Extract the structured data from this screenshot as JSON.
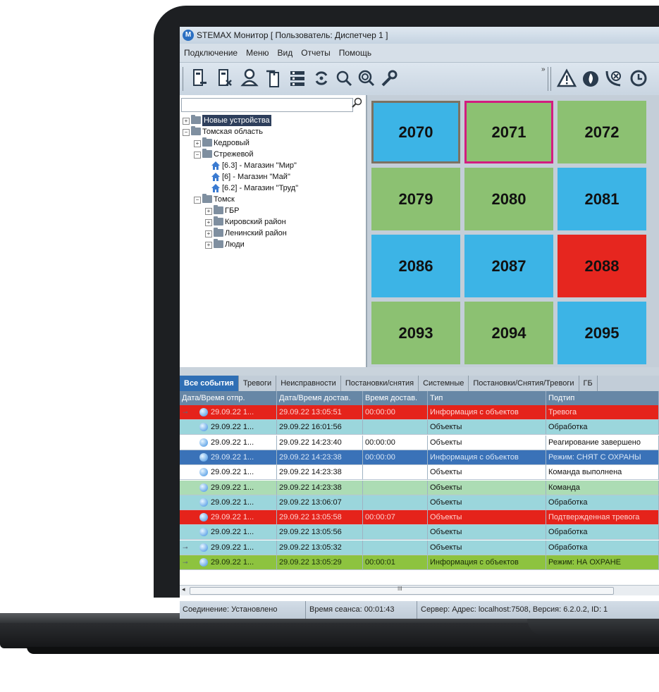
{
  "window": {
    "title": "STEMAX Монитор [ Пользователь: Диспетчер 1 ]",
    "logo_letter": "M"
  },
  "menu": [
    "Подключение",
    "Меню",
    "Вид",
    "Отчеты",
    "Помощь"
  ],
  "toolbar": {
    "icons": [
      "device-remove-icon",
      "device-x-icon",
      "user-icon",
      "pointer-device-icon",
      "list-icon",
      "refresh-icon",
      "search-icon",
      "zoom-in-icon",
      "wrench-icon",
      "alarm-triangle-icon",
      "fire-icon",
      "sound-off-icon",
      "clock-icon"
    ],
    "overflow_label": "»"
  },
  "tree": {
    "search_placeholder": "",
    "nodes": [
      {
        "label": "Новые устройства",
        "kind": "folder",
        "level": 0,
        "toggle": "+",
        "selected": true
      },
      {
        "label": "Томская область",
        "kind": "folder",
        "level": 0,
        "toggle": "−"
      },
      {
        "label": "Кедровый",
        "kind": "folder",
        "level": 1,
        "toggle": "+"
      },
      {
        "label": "Стрежевой",
        "kind": "folder",
        "level": 1,
        "toggle": "−"
      },
      {
        "label": "[6.3] - Магазин \"Мир\"",
        "kind": "object",
        "level": 2
      },
      {
        "label": "[6] - Магазин \"Май\"",
        "kind": "object",
        "level": 2
      },
      {
        "label": "[6.2] - Магазин \"Труд\"",
        "kind": "object",
        "level": 2
      },
      {
        "label": "Томск",
        "kind": "folder",
        "level": 1,
        "toggle": "−"
      },
      {
        "label": "ГБР",
        "kind": "folder",
        "level": 2,
        "toggle": "+"
      },
      {
        "label": "Кировский район",
        "kind": "folder",
        "level": 2,
        "toggle": "+"
      },
      {
        "label": "Ленинский район",
        "kind": "folder",
        "level": 2,
        "toggle": "+"
      },
      {
        "label": "Люди",
        "kind": "folder",
        "level": 2,
        "toggle": "+"
      }
    ]
  },
  "tiles": [
    {
      "number": "2070",
      "color": "#3cb4e6"
    },
    {
      "number": "2071",
      "color": "#8cc172",
      "selected": true
    },
    {
      "number": "2072",
      "color": "#8cc172"
    },
    {
      "number": "2079",
      "color": "#8cc172"
    },
    {
      "number": "2080",
      "color": "#8cc172"
    },
    {
      "number": "2081",
      "color": "#3cb4e6"
    },
    {
      "number": "2086",
      "color": "#3cb4e6"
    },
    {
      "number": "2087",
      "color": "#3cb4e6"
    },
    {
      "number": "2088",
      "color": "#e6261f"
    },
    {
      "number": "2093",
      "color": "#8cc172"
    },
    {
      "number": "2094",
      "color": "#8cc172"
    },
    {
      "number": "2095",
      "color": "#3cb4e6"
    }
  ],
  "events": {
    "tabs": [
      "Все события",
      "Тревоги",
      "Неисправности",
      "Постановки/снятия",
      "Системные",
      "Постановки/Снятия/Тревоги",
      "ГБ"
    ],
    "columns": [
      "Дата/Время отпр.",
      "Дата/Время достав.",
      "Время достав.",
      "Тип",
      "Подтип"
    ],
    "rows": [
      {
        "sent": "29.09.22 1...",
        "delivered": "29.09.22 13:05:51",
        "delay": "00:00:00",
        "type": "Информация с объектов",
        "subtype": "Тревога",
        "bg": "#e5231b",
        "fg": "#ffd2d0",
        "lead": "pin-expand"
      },
      {
        "sent": "29.09.22 1...",
        "delivered": "29.09.22 16:01:56",
        "delay": "",
        "type": "Объекты",
        "subtype": "Обработка",
        "bg": "#9bd6dc",
        "fg": "#111111"
      },
      {
        "sent": "29.09.22 1...",
        "delivered": "29.09.22 14:23:40",
        "delay": "00:00:00",
        "type": "Объекты",
        "subtype": "Реагирование завершено",
        "bg": "#ffffff",
        "fg": "#111111"
      },
      {
        "sent": "29.09.22 1...",
        "delivered": "29.09.22 14:23:38",
        "delay": "00:00:00",
        "type": "Информация с объектов",
        "subtype": "Режим: СНЯТ С ОХРАНЫ",
        "bg": "#3a72b8",
        "fg": "#d8e6f6"
      },
      {
        "sent": "29.09.22 1...",
        "delivered": "29.09.22 14:23:38",
        "delay": "",
        "type": "Объекты",
        "subtype": "Команда выполнена",
        "bg": "#ffffff",
        "fg": "#111111"
      },
      {
        "sent": "29.09.22 1...",
        "delivered": "29.09.22 14:23:38",
        "delay": "",
        "type": "Объекты",
        "subtype": "Команда",
        "bg": "#acdcb4",
        "fg": "#111111"
      },
      {
        "sent": "29.09.22 1...",
        "delivered": "29.09.22 13:06:07",
        "delay": "",
        "type": "Объекты",
        "subtype": "Обработка",
        "bg": "#9bd6dc",
        "fg": "#111111"
      },
      {
        "sent": "29.09.22 1...",
        "delivered": "29.09.22 13:05:58",
        "delay": "00:00:07",
        "type": "Объекты",
        "subtype": "Подтвержденная тревога",
        "bg": "#e5231b",
        "fg": "#ffd2d0"
      },
      {
        "sent": "29.09.22 1...",
        "delivered": "29.09.22 13:05:56",
        "delay": "",
        "type": "Объекты",
        "subtype": "Обработка",
        "bg": "#9bd6dc",
        "fg": "#111111"
      },
      {
        "sent": "29.09.22 1...",
        "delivered": "29.09.22 13:05:32",
        "delay": "",
        "type": "Объекты",
        "subtype": "Обработка",
        "bg": "#9bd6dc",
        "fg": "#111111",
        "lead": "pin"
      },
      {
        "sent": "29.09.22 1...",
        "delivered": "29.09.22 13:05:29",
        "delay": "00:00:01",
        "type": "Информация с объектов",
        "subtype": "Режим: НА ОХРАНЕ",
        "bg": "#8dc33f",
        "fg": "#1b2e0a",
        "lead": "pin"
      }
    ]
  },
  "status": {
    "connection": "Соединение: Установлено",
    "session": "Время сеанса: 00:01:43",
    "server": "Сервер: Адрес: localhost:7508, Версия: 6.2.0.2, ID: 1"
  },
  "scrollbar_grip": "III"
}
